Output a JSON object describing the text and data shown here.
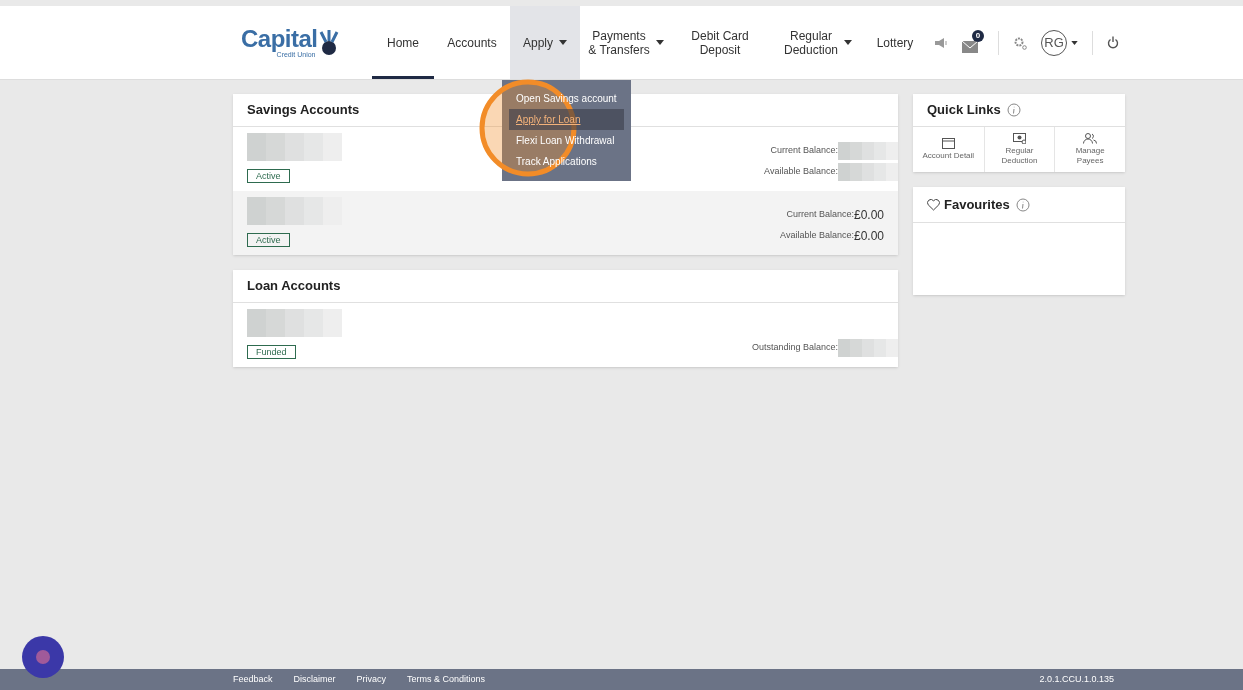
{
  "logo": {
    "name": "Capital",
    "tagline": "Credit Union"
  },
  "nav": {
    "items": [
      {
        "label": "Home",
        "selected": true,
        "open": false,
        "caret": false
      },
      {
        "label": "Accounts",
        "selected": false,
        "open": false,
        "caret": false
      },
      {
        "label": "Apply",
        "selected": false,
        "open": true,
        "caret": true
      },
      {
        "label": "Payments\n& Transfers",
        "selected": false,
        "open": false,
        "caret": true
      },
      {
        "label": "Debit Card\nDeposit",
        "selected": false,
        "open": false,
        "caret": false
      },
      {
        "label": "Regular\nDeduction",
        "selected": false,
        "open": false,
        "caret": true
      },
      {
        "label": "Lottery",
        "selected": false,
        "open": false,
        "caret": false
      }
    ],
    "message_count": "0",
    "avatar": "RG"
  },
  "dropdown": {
    "items": [
      {
        "label": "Open Savings account",
        "selected": false
      },
      {
        "label": "Apply for Loan",
        "selected": true
      },
      {
        "label": "Flexi Loan Withdrawal",
        "selected": false
      },
      {
        "label": "Track Applications",
        "selected": false
      }
    ]
  },
  "savings": {
    "title": "Savings Accounts",
    "rows": [
      {
        "status": "Active",
        "highlighted": false,
        "balances": [
          {
            "label": "Current Balance:"
          },
          {
            "label": "Available Balance:"
          }
        ]
      },
      {
        "status": "Active",
        "highlighted": true,
        "balances": [
          {
            "label": "Current Balance:",
            "value": "£0.00"
          },
          {
            "label": "Available Balance:",
            "value": "£0.00"
          }
        ]
      }
    ]
  },
  "loans": {
    "title": "Loan Accounts",
    "rows": [
      {
        "status": "Funded",
        "highlighted": false,
        "balances": [
          {
            "label": "Outstanding Balance:"
          }
        ]
      }
    ]
  },
  "quick_links": {
    "title": "Quick Links",
    "items": [
      {
        "kind": "account",
        "label": "Account Detail"
      },
      {
        "kind": "deduction",
        "label": "Regular\nDeduction"
      },
      {
        "kind": "payees",
        "label": "Manage\nPayees"
      }
    ]
  },
  "favourites": {
    "title": "Favourites"
  },
  "footer": {
    "links": [
      "Feedback",
      "Disclaimer",
      "Privacy",
      "Terms & Conditions"
    ],
    "version": "2.0.1.CCU.1.0.135"
  }
}
